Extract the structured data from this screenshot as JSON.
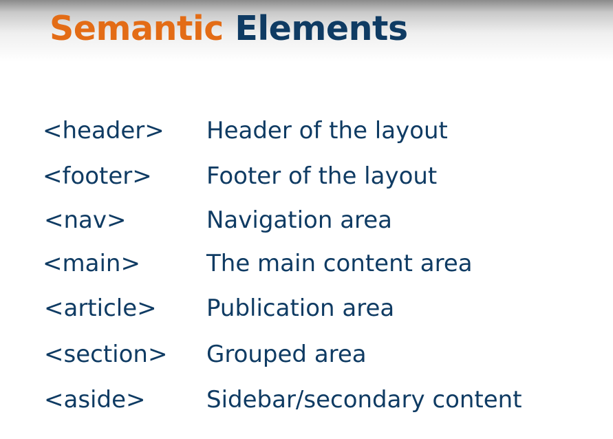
{
  "title": {
    "word1": "Semantic",
    "word2": "Elements"
  },
  "colors": {
    "accent_orange": "#e36c16",
    "brand_navy": "#0f3b63"
  },
  "rows": [
    {
      "tag": "<header>",
      "description": "Header of the layout"
    },
    {
      "tag": "<footer>",
      "description": "Footer of the layout"
    },
    {
      "tag": "<nav>",
      "description": "Navigation area"
    },
    {
      "tag": "<main>",
      "description": "The main content area"
    },
    {
      "tag": "<article>",
      "description": "Publication area"
    },
    {
      "tag": "<section>",
      "description": "Grouped area"
    },
    {
      "tag": "<aside>",
      "description": "Sidebar/secondary content"
    }
  ]
}
